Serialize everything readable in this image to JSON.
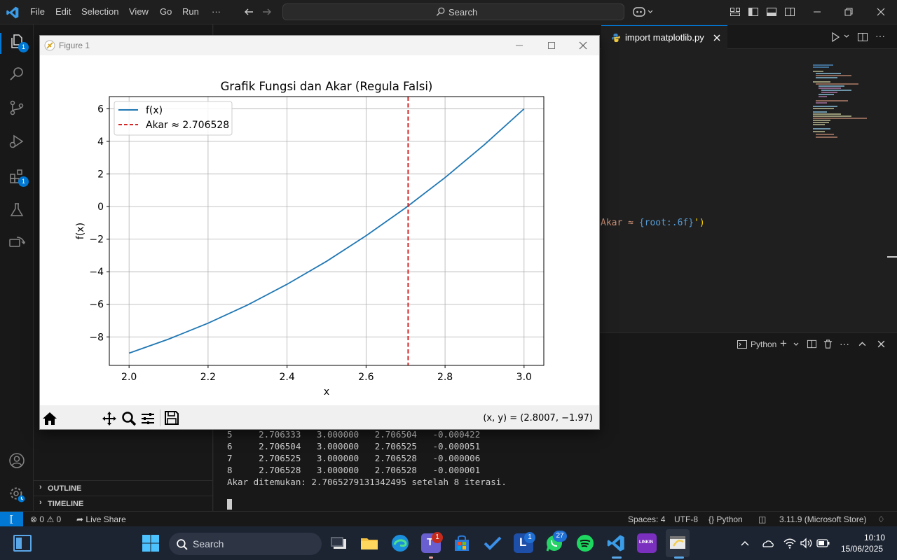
{
  "menu": [
    "File",
    "Edit",
    "Selection",
    "View",
    "Go",
    "Run",
    "···"
  ],
  "command_center": {
    "label": "Search"
  },
  "activity_badges": {
    "explorer": "1",
    "extensions": "1"
  },
  "sidebar": {
    "outline": "OUTLINE",
    "timeline": "TIMELINE"
  },
  "editor": {
    "active_tab": "import matplotlib.py",
    "code_fragment_text": "Akar ≈ ",
    "code_fragment_expr": "{root:.6f}",
    "code_fragment_end": "')"
  },
  "panel": {
    "terminal_profile": "Python",
    "terminal_lines": [
      "5     2.706333   3.000000   2.706504   -0.000422",
      "6     2.706504   3.000000   2.706525   -0.000051",
      "7     2.706525   3.000000   2.706528   -0.000006",
      "8     2.706528   3.000000   2.706528   -0.000001",
      "",
      "Akar ditemukan: 2.7065279131342495 setelah 8 iterasi."
    ]
  },
  "statusbar": {
    "errors": "0",
    "warnings": "0",
    "live_share": "Live Share",
    "spaces": "Spaces: 4",
    "encoding": "UTF-8",
    "language": "Python",
    "interpreter": "3.11.9 (Microsoft Store)"
  },
  "taskbar": {
    "search": "Search",
    "time": "10:10",
    "date": "15/06/2025",
    "teams_badge": "1",
    "l_badge": "1",
    "whatsapp_badge": "27"
  },
  "figure": {
    "window_title": "Figure 1",
    "coords_readout": "(x, y) = (2.8007, −1.97)"
  },
  "chart_data": {
    "type": "line",
    "title": "Grafik Fungsi dan Akar (Regula Falsi)",
    "xlabel": "x",
    "ylabel": "f(x)",
    "xlim": [
      1.95,
      3.05
    ],
    "ylim": [
      -9.75,
      6.75
    ],
    "x_ticks": [
      2.0,
      2.2,
      2.4,
      2.6,
      2.8,
      3.0
    ],
    "x_tick_labels": [
      "2.0",
      "2.2",
      "2.4",
      "2.6",
      "2.8",
      "3.0"
    ],
    "y_ticks": [
      -8,
      -6,
      -4,
      -2,
      0,
      2,
      4,
      6
    ],
    "y_tick_labels": [
      "−8",
      "−6",
      "−4",
      "−2",
      "0",
      "2",
      "4",
      "6"
    ],
    "grid": true,
    "legend_position": "upper-left",
    "series": [
      {
        "name": "f(x)",
        "color": "#1f77b4",
        "style": "solid",
        "x": [
          2.0,
          2.1,
          2.2,
          2.3,
          2.4,
          2.5,
          2.6,
          2.7,
          2.8,
          2.9,
          3.0
        ],
        "y": [
          -9.0,
          -8.14,
          -7.16,
          -6.04,
          -4.77,
          -3.36,
          -1.79,
          -0.08,
          1.78,
          3.81,
          6.0
        ]
      },
      {
        "name": "Akar ≈ 2.706528",
        "color": "#d62728",
        "style": "dashed",
        "vline_x": 2.706528
      }
    ]
  }
}
